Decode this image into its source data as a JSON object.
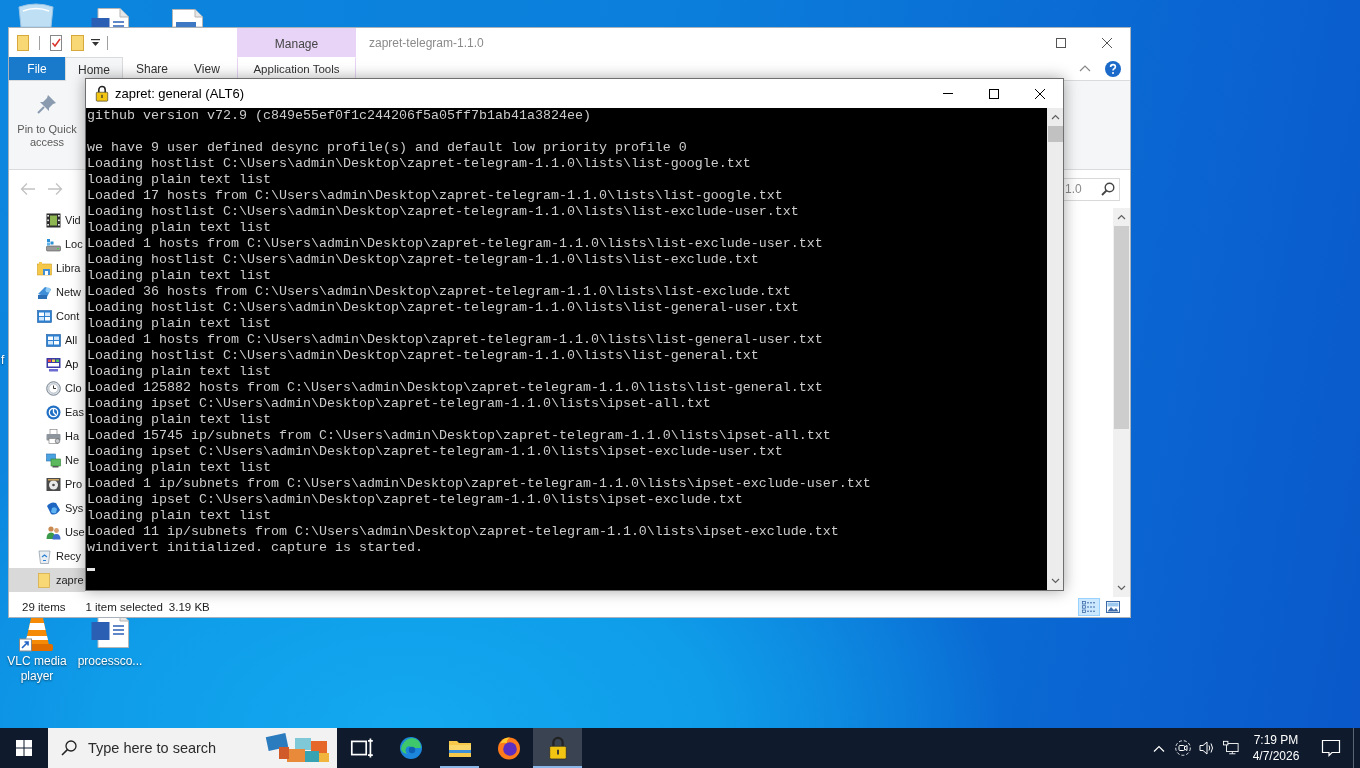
{
  "desktop": {
    "icons": [
      {
        "kind": "recycle-bin"
      },
      {
        "kind": "word-document"
      },
      {
        "kind": "document"
      },
      {
        "kind": "hidden",
        "label": "f"
      },
      {
        "kind": "vlc",
        "label": "VLC media player"
      },
      {
        "kind": "word-document",
        "label": "processco..."
      }
    ]
  },
  "explorer": {
    "title": "zapret-telegram-1.1.0",
    "context_tab": "Manage",
    "tabs": [
      {
        "label": "File",
        "kind": "file",
        "selected": false
      },
      {
        "label": "Home",
        "kind": "tab",
        "selected": true
      },
      {
        "label": "Share",
        "kind": "tab",
        "selected": false
      },
      {
        "label": "View",
        "kind": "tab",
        "selected": false
      },
      {
        "label": "Application Tools",
        "kind": "context",
        "selected": false
      }
    ],
    "pin_button": "Pin to Quick access",
    "nav_buttons": [
      {
        "kind": "back",
        "disabled": true
      },
      {
        "kind": "forward",
        "disabled": true
      }
    ],
    "search": {
      "placeholder": "1.0"
    },
    "nav": [
      {
        "children": [
          {
            "label": "Vid",
            "kind": "video",
            "selected": false
          },
          {
            "label": "Loc",
            "kind": "disk",
            "selected": false
          }
        ]
      },
      {
        "label": "Libra",
        "kind": "library",
        "selected": false
      },
      {
        "label": "Netw",
        "kind": "network",
        "selected": false
      },
      {
        "label": "Cont",
        "kind": "control-panel",
        "selected": false,
        "children": [
          {
            "label": "All",
            "kind": "cp-items",
            "selected": false
          },
          {
            "label": "Ap",
            "kind": "appearance",
            "selected": false
          },
          {
            "label": "Clo",
            "kind": "clock",
            "selected": false
          },
          {
            "label": "Eas",
            "kind": "ease",
            "selected": false
          },
          {
            "label": "Ha",
            "kind": "hardware",
            "selected": false
          },
          {
            "label": "Ne",
            "kind": "network-center",
            "selected": false
          },
          {
            "label": "Pro",
            "kind": "programs",
            "selected": false
          },
          {
            "label": "Sys",
            "kind": "system",
            "selected": false
          },
          {
            "label": "Use",
            "kind": "users",
            "selected": false
          }
        ]
      },
      {
        "label": "Recy",
        "kind": "recycle",
        "selected": false
      },
      {
        "label": "zapre",
        "kind": "folder",
        "selected": true
      }
    ],
    "status": {
      "count": "29 items",
      "selection": "1 item selected",
      "size": "3.19 KB"
    },
    "views": [
      {
        "kind": "details",
        "selected": true
      },
      {
        "kind": "large-icons",
        "selected": false
      }
    ]
  },
  "console": {
    "title": "zapret: general (ALT6)",
    "blocks": [
      [
        "github version v72.9 (c849e55ef0f1c244206f5a05ff7b1ab41a3824ee)"
      ],
      [
        "we have 9 user defined desync profile(s) and default low priority profile 0",
        "Loading hostlist C:\\Users\\admin\\Desktop\\zapret-telegram-1.1.0\\lists\\list-google.txt",
        "loading plain text list",
        "Loaded 17 hosts from C:\\Users\\admin\\Desktop\\zapret-telegram-1.1.0\\lists\\list-google.txt",
        "Loading hostlist C:\\Users\\admin\\Desktop\\zapret-telegram-1.1.0\\lists\\list-exclude-user.txt",
        "loading plain text list",
        "Loaded 1 hosts from C:\\Users\\admin\\Desktop\\zapret-telegram-1.1.0\\lists\\list-exclude-user.txt",
        "Loading hostlist C:\\Users\\admin\\Desktop\\zapret-telegram-1.1.0\\lists\\list-exclude.txt",
        "loading plain text list",
        "Loaded 36 hosts from C:\\Users\\admin\\Desktop\\zapret-telegram-1.1.0\\lists\\list-exclude.txt",
        "Loading hostlist C:\\Users\\admin\\Desktop\\zapret-telegram-1.1.0\\lists\\list-general-user.txt",
        "loading plain text list",
        "Loaded 1 hosts from C:\\Users\\admin\\Desktop\\zapret-telegram-1.1.0\\lists\\list-general-user.txt",
        "Loading hostlist C:\\Users\\admin\\Desktop\\zapret-telegram-1.1.0\\lists\\list-general.txt",
        "loading plain text list",
        "Loaded 125882 hosts from C:\\Users\\admin\\Desktop\\zapret-telegram-1.1.0\\lists\\list-general.txt",
        "Loading ipset C:\\Users\\admin\\Desktop\\zapret-telegram-1.1.0\\lists\\ipset-all.txt",
        "loading plain text list",
        "Loaded 15745 ip/subnets from C:\\Users\\admin\\Desktop\\zapret-telegram-1.1.0\\lists\\ipset-all.txt",
        "Loading ipset C:\\Users\\admin\\Desktop\\zapret-telegram-1.1.0\\lists\\ipset-exclude-user.txt",
        "loading plain text list",
        "Loaded 1 ip/subnets from C:\\Users\\admin\\Desktop\\zapret-telegram-1.1.0\\lists\\ipset-exclude-user.txt",
        "Loading ipset C:\\Users\\admin\\Desktop\\zapret-telegram-1.1.0\\lists\\ipset-exclude.txt",
        "loading plain text list",
        "Loaded 11 ip/subnets from C:\\Users\\admin\\Desktop\\zapret-telegram-1.1.0\\lists\\ipset-exclude.txt",
        "windivert initialized. capture is started."
      ]
    ]
  },
  "taskbar": {
    "search_placeholder": "Type here to search",
    "apps": [
      {
        "kind": "task-view",
        "running": false,
        "selected": false
      },
      {
        "kind": "edge",
        "running": false,
        "selected": false
      },
      {
        "kind": "explorer",
        "running": true,
        "selected": false
      },
      {
        "kind": "firefox",
        "running": false,
        "selected": false
      },
      {
        "kind": "padlock",
        "running": true,
        "selected": true
      }
    ],
    "clock": {
      "time": "7:19 PM",
      "date": "4/7/2026"
    }
  }
}
